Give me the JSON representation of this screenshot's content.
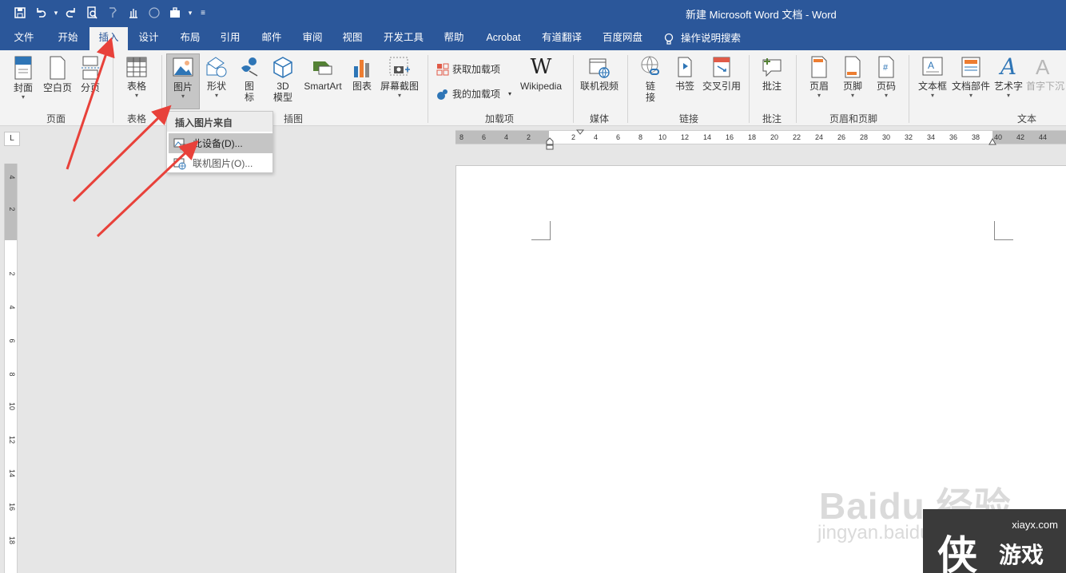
{
  "window": {
    "title": "新建 Microsoft Word 文档  -  Word"
  },
  "qat": {
    "icons": [
      "save-icon",
      "undo-icon",
      "redo-icon",
      "print-preview-icon",
      "format-painter-icon",
      "touch-mode-icon",
      "circle-icon",
      "briefcase-icon",
      "customize-icon"
    ]
  },
  "tabs": [
    {
      "label": "文件"
    },
    {
      "label": "开始"
    },
    {
      "label": "插入"
    },
    {
      "label": "设计"
    },
    {
      "label": "布局"
    },
    {
      "label": "引用"
    },
    {
      "label": "邮件"
    },
    {
      "label": "审阅"
    },
    {
      "label": "视图"
    },
    {
      "label": "开发工具"
    },
    {
      "label": "帮助"
    },
    {
      "label": "Acrobat"
    },
    {
      "label": "有道翻译"
    },
    {
      "label": "百度网盘"
    }
  ],
  "tell_me": "操作说明搜索",
  "ribbon": {
    "buttons": {
      "cover": "封面",
      "blank": "空白页",
      "break": "分页",
      "table": "表格",
      "picture": "图片",
      "shapes": "形状",
      "icons1": "图",
      "icons2": "标",
      "model1": "3D",
      "model2": "模型",
      "smartart": "SmartArt",
      "chart": "图表",
      "screenshot": "屏幕截图",
      "get_addins": "获取加载项",
      "my_addins": "我的加载项",
      "wikipedia": "Wikipedia",
      "online_video": "联机视频",
      "link1": "链",
      "link2": "接",
      "bookmark": "书签",
      "cross_ref": "交叉引用",
      "comment": "批注",
      "header": "页眉",
      "footer": "页脚",
      "page_number": "页码",
      "textbox": "文本框",
      "quick_parts": "文档部件",
      "wordart": "艺术字",
      "dropcap": "首字下沉"
    },
    "groups": {
      "pages": "页面",
      "tables": "表格",
      "illustrations": "插图",
      "addins": "加载项",
      "media": "媒体",
      "links": "链接",
      "comments": "批注",
      "header_footer": "页眉和页脚",
      "text": "文本"
    }
  },
  "dropdown": {
    "header": "插入图片来自",
    "items": [
      {
        "label": "此设备(D)..."
      },
      {
        "label": "联机图片(O)..."
      }
    ]
  },
  "hruler": {
    "ticks": [
      "8",
      "6",
      "4",
      "2",
      "2",
      "4",
      "6",
      "8",
      "10",
      "12",
      "14",
      "16",
      "18",
      "20",
      "22",
      "24",
      "26",
      "28",
      "30",
      "32",
      "34",
      "36",
      "38",
      "40",
      "42",
      "44"
    ]
  },
  "vruler": {
    "ticks": [
      "4",
      "2",
      "2",
      "4",
      "6",
      "8",
      "10",
      "12",
      "14",
      "16",
      "18"
    ]
  },
  "watermark": {
    "text": "Baidu 经验",
    "url": "jingyan.baidu.com"
  },
  "corner_logo": {
    "site": "xiayx.com",
    "char": "侠",
    "game": "游戏"
  },
  "colors": {
    "title_bar": "#2b579a",
    "ribbon": "#f3f3f3",
    "arrow": "#e8413a"
  }
}
